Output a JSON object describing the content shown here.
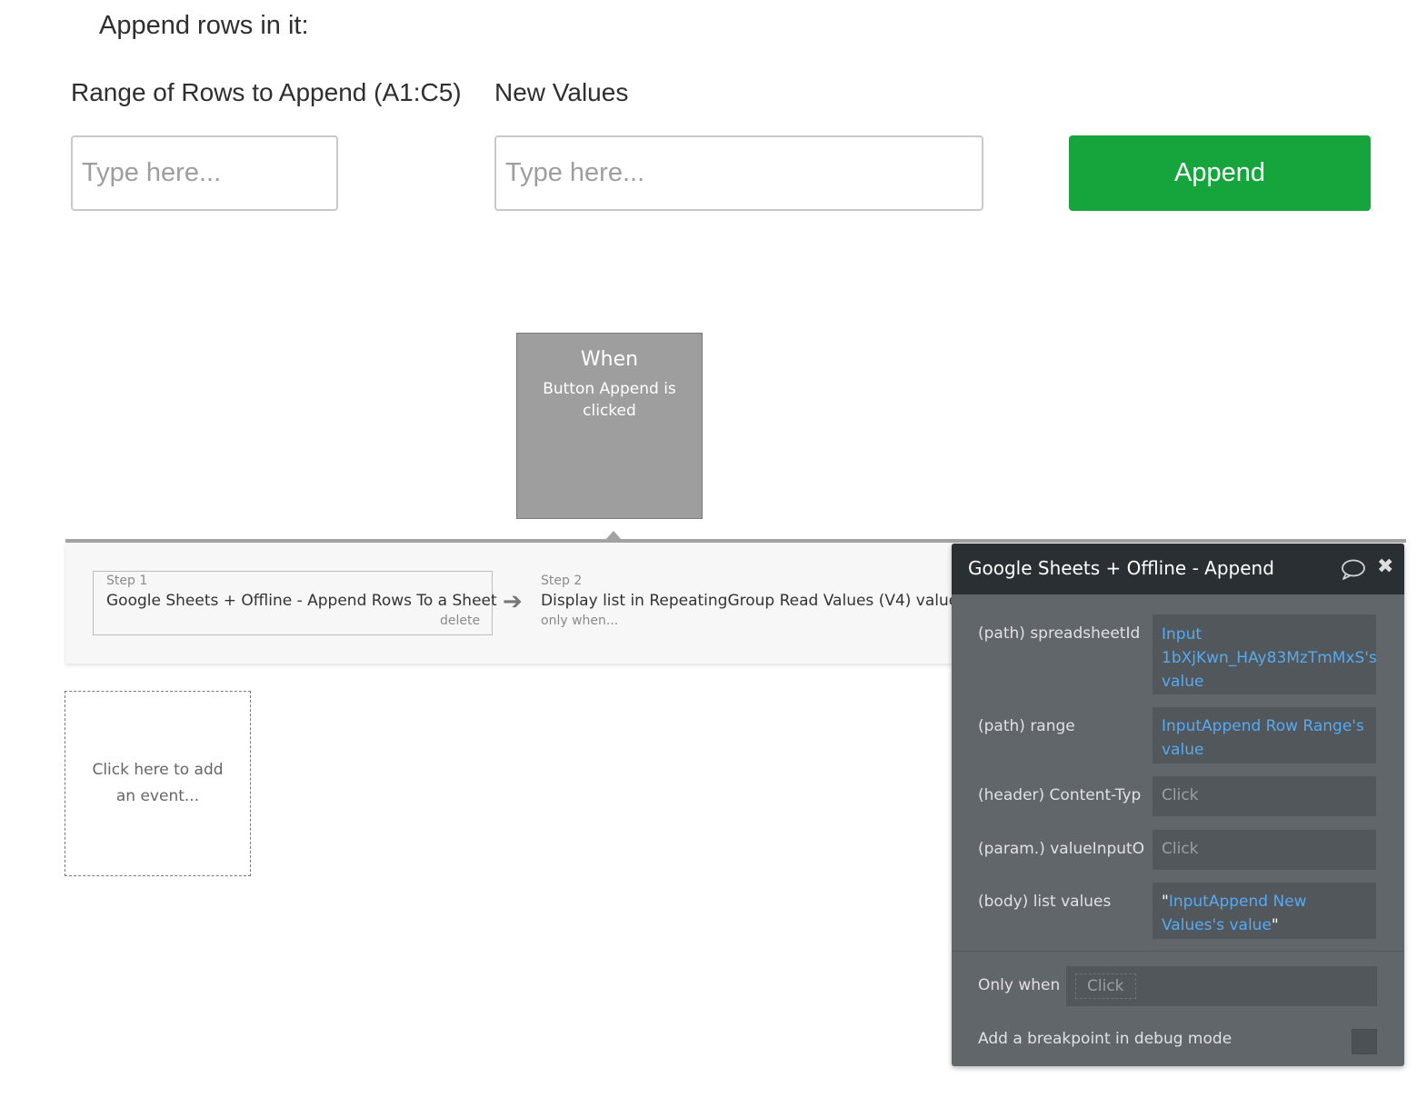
{
  "form": {
    "heading": "Append rows in it:",
    "range_label": "Range of Rows to Append (A1:C5)",
    "values_label": "New Values",
    "range_placeholder": "Type here...",
    "values_placeholder": "Type here...",
    "append_button": "Append",
    "colors": {
      "button": "#16a53c"
    }
  },
  "event": {
    "title": "When",
    "subtitle": "Button Append is clicked"
  },
  "steps": [
    {
      "num": "Step 1",
      "title": "Google Sheets + Offline - Append Rows To a Sheet",
      "action": "delete"
    },
    {
      "num": "Step 2",
      "title": "Display list in RepeatingGroup Read Values (V4) value",
      "action": "only when..."
    }
  ],
  "add_event": "Click here to add an event...",
  "editor": {
    "title": "Google Sheets + Offline - Append",
    "icons": [
      "comment-icon",
      "close-icon"
    ],
    "fields": [
      {
        "label": "(path) spreadsheetId",
        "value": "Input 1bXjKwn_HAy83MzTmMxS's value"
      },
      {
        "label": "(path) range",
        "value": "InputAppend Row Range's value"
      },
      {
        "label": "(header) Content-Typ",
        "value": "Click"
      },
      {
        "label": "(param.) valueInputO",
        "value": "Click"
      },
      {
        "label": "(body) list values",
        "value": "InputAppend New Values's value",
        "quote": "\""
      }
    ],
    "only_when_label": "Only when",
    "only_when_value": "Click",
    "breakpoint_label": "Add a breakpoint in debug mode"
  }
}
